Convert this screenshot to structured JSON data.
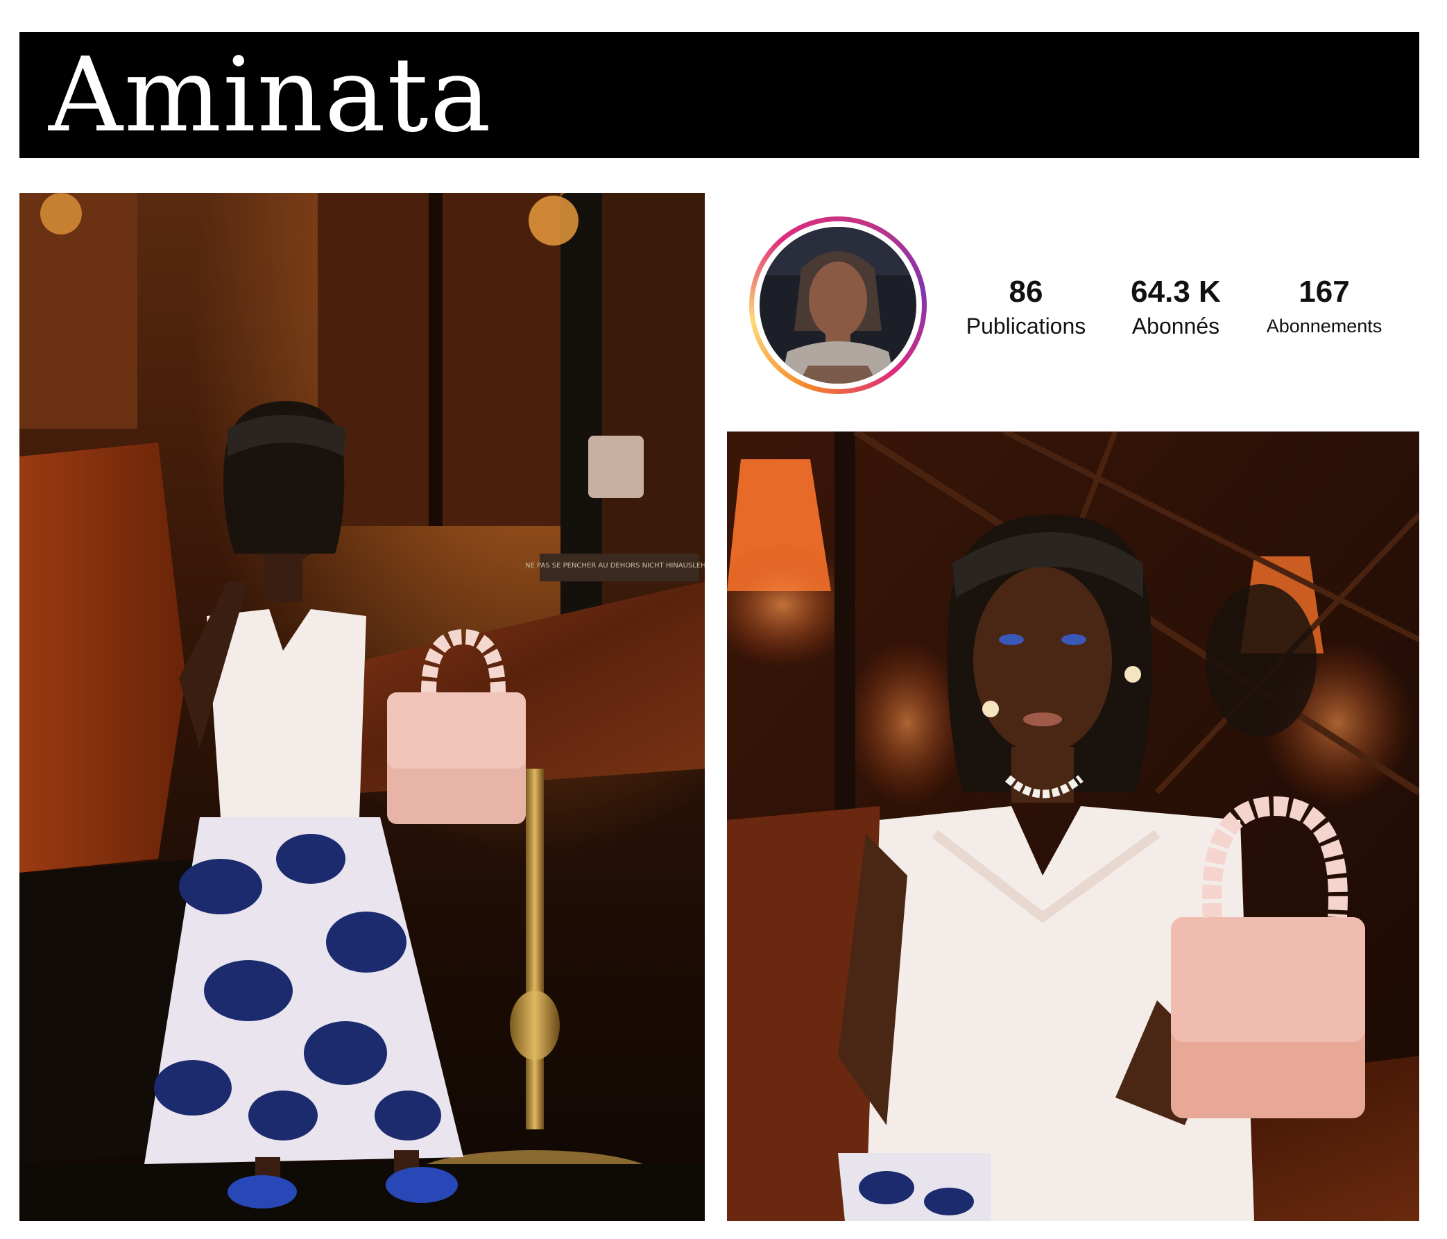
{
  "header": {
    "name": "Aminata"
  },
  "profile": {
    "stats": [
      {
        "value": "86",
        "label": "Publications"
      },
      {
        "value": "64.3 K",
        "label": "Abonnés"
      },
      {
        "value": "167",
        "label": "Abonnements"
      }
    ]
  },
  "photos": {
    "left_sign": "NE PAS SE PENCHER AU DEHORS NICHT HINAUSLEHNEN"
  },
  "colors": {
    "title_bar": "#000000",
    "title_text": "#ffffff",
    "ring_gradient": [
      "#f58529",
      "#feda77",
      "#dd2a7b",
      "#c13584",
      "#8134af"
    ],
    "stat_text": "#111111"
  }
}
